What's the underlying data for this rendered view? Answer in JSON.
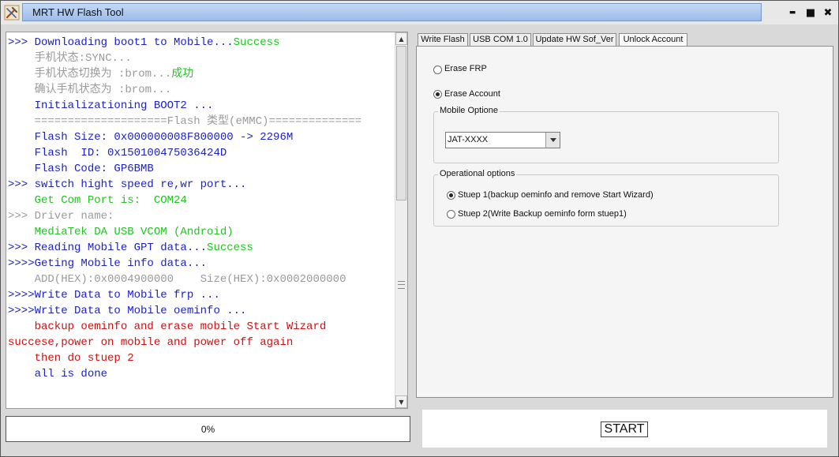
{
  "window": {
    "title": "MRT HW Flash Tool"
  },
  "log": {
    "lines": [
      {
        "parts": [
          {
            "text": ">>> Downloading boot1 to Mobile...",
            "color": "#1c22c8"
          },
          {
            "text": "Success",
            "color": "#22c322"
          }
        ]
      },
      {
        "parts": [
          {
            "text": "    手机状态:SYNC...",
            "color": "#9a9a9a"
          }
        ]
      },
      {
        "parts": [
          {
            "text": "    手机状态切换为 :brom...",
            "color": "#9a9a9a"
          },
          {
            "text": "成功",
            "color": "#22c322"
          }
        ]
      },
      {
        "parts": [
          {
            "text": "    确认手机状态为 :brom...",
            "color": "#9a9a9a"
          }
        ]
      },
      {
        "parts": [
          {
            "text": "    Initializationing BOOT2 ...",
            "color": "#1c22c8"
          }
        ]
      },
      {
        "parts": [
          {
            "text": "    ====================Flash 类型(eMMC)==============",
            "color": "#9a9a9a"
          }
        ]
      },
      {
        "parts": [
          {
            "text": "    Flash Size: 0x000000008F800000 -> 2296M",
            "color": "#1c22c8"
          }
        ]
      },
      {
        "parts": [
          {
            "text": "    Flash  ID: 0x150100475036424D",
            "color": "#1c22c8"
          }
        ]
      },
      {
        "parts": [
          {
            "text": "    Flash Code: GP6BMB",
            "color": "#1c22c8"
          }
        ]
      },
      {
        "parts": [
          {
            "text": ">>> switch hight speed re,wr port...",
            "color": "#1c22c8"
          }
        ]
      },
      {
        "parts": [
          {
            "text": "    Get Com Port is:  COM24",
            "color": "#22c322"
          }
        ]
      },
      {
        "parts": [
          {
            "text": ">>> Driver name:",
            "color": "#9a9a9a"
          }
        ]
      },
      {
        "parts": [
          {
            "text": "    MediaTek DA USB VCOM (Android)",
            "color": "#22c322"
          }
        ]
      },
      {
        "parts": [
          {
            "text": ">>> Reading Mobile GPT data...",
            "color": "#1c22c8"
          },
          {
            "text": "Success",
            "color": "#22c322"
          }
        ]
      },
      {
        "parts": [
          {
            "text": ">>>>Geting Mobile info data...",
            "color": "#1c22c8"
          }
        ]
      },
      {
        "parts": [
          {
            "text": "    ADD(HEX):0x0004900000    Size(HEX):0x0002000000",
            "color": "#9a9a9a"
          }
        ]
      },
      {
        "parts": [
          {
            "text": ">>>>Write Data to Mobile frp ...",
            "color": "#1c22c8"
          }
        ]
      },
      {
        "parts": [
          {
            "text": ">>>>Write Data to Mobile oeminfo ...",
            "color": "#1c22c8"
          }
        ]
      },
      {
        "parts": [
          {
            "text": "    backup oeminfo and erase mobile Start Wizard",
            "color": "#cc1111"
          }
        ]
      },
      {
        "parts": [
          {
            "text": "succese,power on mobile and power off again",
            "color": "#cc1111"
          }
        ]
      },
      {
        "parts": [
          {
            "text": "    then do stuep 2",
            "color": "#cc1111"
          }
        ]
      },
      {
        "parts": [
          {
            "text": "    all is done",
            "color": "#1c22c8"
          }
        ]
      }
    ]
  },
  "progress": {
    "value": 0,
    "text": "0%"
  },
  "tabs": [
    {
      "label": "Write Flash",
      "active": false
    },
    {
      "label": "USB COM 1.0",
      "active": false
    },
    {
      "label": "Update HW Sof_Ver",
      "active": false
    },
    {
      "label": "Unlock Account",
      "active": true
    }
  ],
  "unlock": {
    "erase_frp": {
      "label": "Erase FRP",
      "checked": false
    },
    "erase_account": {
      "label": "Erase Account",
      "checked": true
    },
    "mobile_option": {
      "title": "Mobile Optione",
      "value": "JAT-XXXX"
    },
    "operational": {
      "title": "Operational options",
      "step1": {
        "label": "Stuep 1(backup oeminfo and remove Start Wizard)",
        "checked": true
      },
      "step2": {
        "label": "Stuep 2(Write Backup oeminfo form stuep1)",
        "checked": false
      }
    }
  },
  "start_button": "START",
  "controls": {
    "minimize": "▬",
    "maximize": "■",
    "close": "✖"
  }
}
